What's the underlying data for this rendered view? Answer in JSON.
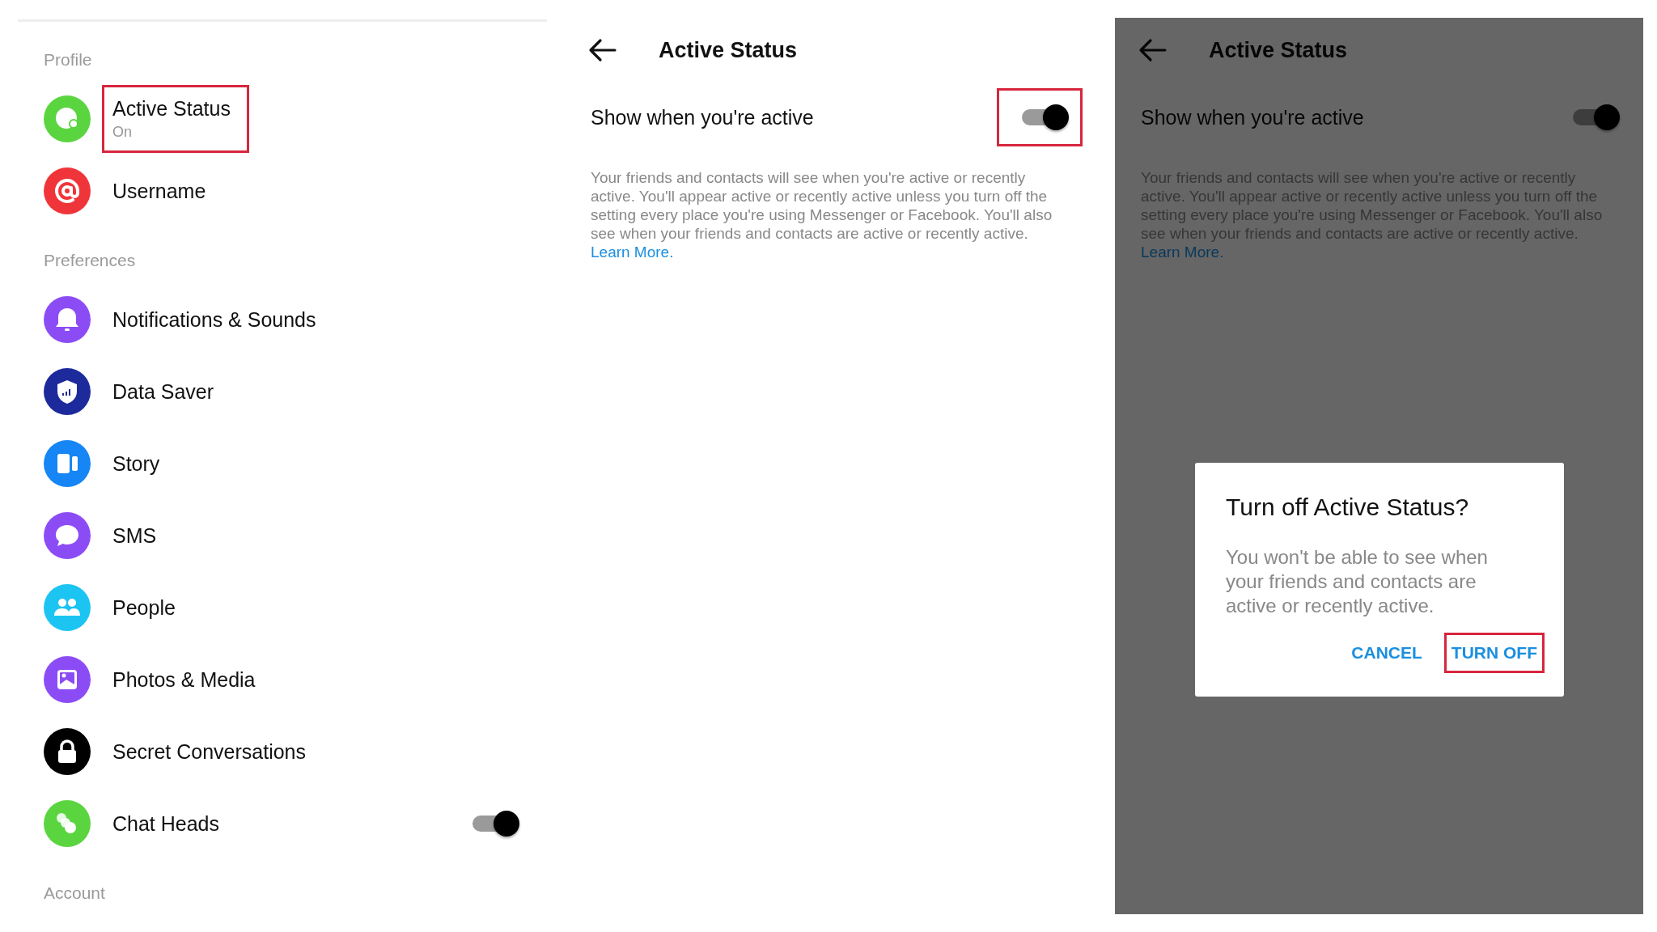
{
  "settings_list": {
    "sections": [
      {
        "heading": "Profile",
        "items": [
          {
            "label": "Active Status",
            "sublabel": "On",
            "color": "#5ad53f",
            "highlighted": true
          },
          {
            "label": "Username",
            "color": "#f0353a",
            "highlighted": false
          }
        ]
      },
      {
        "heading": "Preferences",
        "items": [
          {
            "label": "Notifications & Sounds",
            "color": "#8c4cf5",
            "highlighted": false
          },
          {
            "label": "Data Saver",
            "color": "#1d2a9c",
            "highlighted": false
          },
          {
            "label": "Story",
            "color": "#1685f5",
            "highlighted": false
          },
          {
            "label": "SMS",
            "color": "#8c4cf5",
            "highlighted": false
          },
          {
            "label": "People",
            "color": "#1cc4f2",
            "highlighted": false
          },
          {
            "label": "Photos & Media",
            "color": "#8c4cf5",
            "highlighted": false
          },
          {
            "label": "Secret Conversations",
            "color": "#000000",
            "highlighted": false
          },
          {
            "label": "Chat Heads",
            "color": "#5ad53f",
            "highlighted": false,
            "kind": "toggle",
            "on": true
          }
        ]
      },
      {
        "heading": "Account"
      }
    ]
  },
  "active_status_screen": {
    "title": "Active Status",
    "setting": {
      "label": "Show when you're active",
      "on": true,
      "highlighted": true
    },
    "description": "Your friends and contacts will see when you're active or recently active. You'll appear active or recently active unless you turn off the setting every place you're using Messenger or Facebook. You'll also see when your friends and contacts are active or recently active.",
    "learn_more": "Learn More."
  },
  "active_status_with_dialog": {
    "title": "Active Status",
    "setting": {
      "label": "Show when you're active",
      "on": true
    },
    "description": "Your friends and contacts will see when you're active or recently active. You'll appear active or recently active unless you turn off the setting every place you're using Messenger or Facebook. You'll also see when your friends and contacts are active or recently active.",
    "learn_more": "Learn More.",
    "dialog": {
      "title": "Turn off Active Status?",
      "message": "You won't be able to see when your friends and contacts are active or recently active.",
      "buttons": [
        {
          "label": "CANCEL",
          "highlighted": false
        },
        {
          "label": "TURN OFF",
          "highlighted": true
        }
      ]
    }
  }
}
